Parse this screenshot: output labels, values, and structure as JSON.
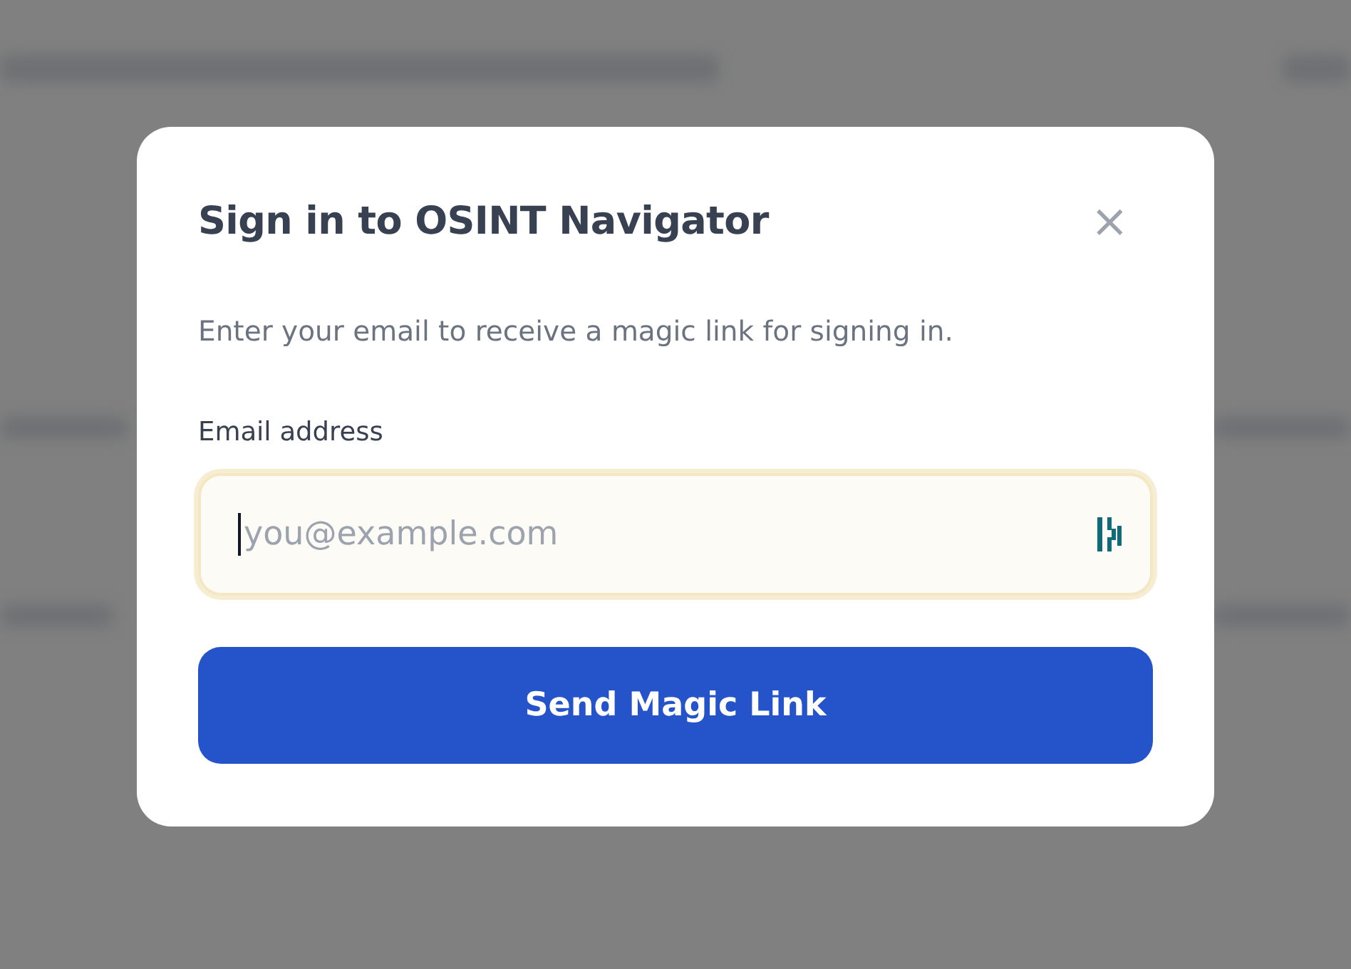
{
  "dialog": {
    "title": "Sign in to OSINT Navigator",
    "close_icon": "×",
    "description": "Enter your email to receive a magic link for signing in.",
    "email_field": {
      "label": "Email address",
      "placeholder": "you@example.com",
      "focused": true
    },
    "submit_button": "Send Magic Link"
  }
}
